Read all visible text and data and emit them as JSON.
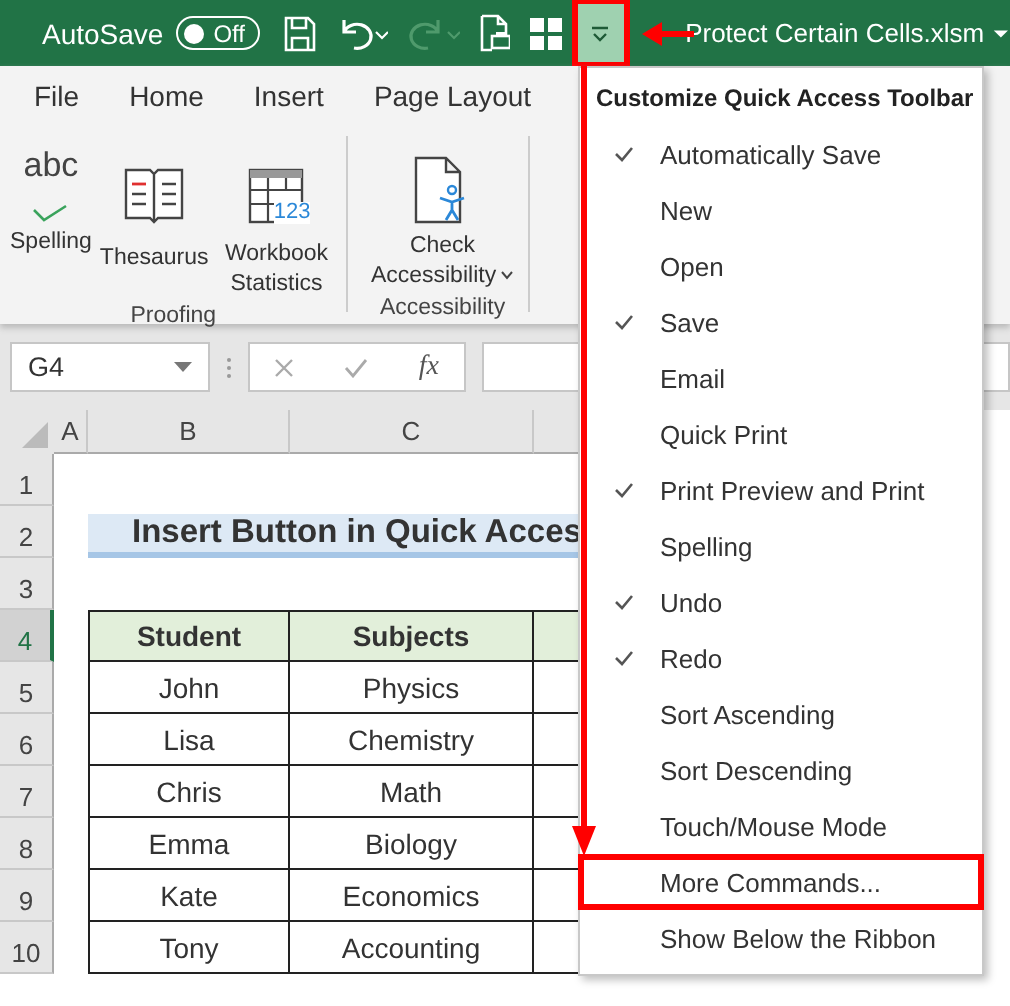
{
  "title_bar": {
    "autosave_label": "AutoSave",
    "autosave_toggle": {
      "label": "Off",
      "on": false
    },
    "redo_disabled": true,
    "filename": "Protect Certain Cells.xlsm"
  },
  "ribbon": {
    "tabs": [
      {
        "label": "File",
        "selected": false
      },
      {
        "label": "Home",
        "selected": false
      },
      {
        "label": "Insert",
        "selected": false
      },
      {
        "label": "Page Layout",
        "selected": false
      }
    ],
    "groups": [
      {
        "label": "Proofing",
        "commands": [
          {
            "kind": "spelling",
            "label": "Spelling",
            "icon_text": "abc"
          },
          {
            "kind": "thesaurus",
            "label": "Thesaurus"
          },
          {
            "kind": "statistics",
            "label": "Workbook Statistics",
            "icon_text": "123"
          }
        ]
      },
      {
        "label": "Accessibility",
        "commands": [
          {
            "kind": "accessibility",
            "label": "Check Accessibility",
            "has_menu": true
          }
        ]
      }
    ]
  },
  "formula_bar": {
    "name_box": "G4",
    "function_label": "fx"
  },
  "sheet": {
    "columns": [
      "A",
      "B",
      "C"
    ],
    "row_headers": [
      {
        "label": "1",
        "selected": false
      },
      {
        "label": "2",
        "selected": false
      },
      {
        "label": "3",
        "selected": false
      },
      {
        "label": "4",
        "selected": true
      },
      {
        "label": "5",
        "selected": false
      },
      {
        "label": "6",
        "selected": false
      },
      {
        "label": "7",
        "selected": false
      },
      {
        "label": "8",
        "selected": false
      },
      {
        "label": "9",
        "selected": false
      },
      {
        "label": "10",
        "selected": false
      }
    ],
    "title": "Insert Button in Quick Acces",
    "table_headers": [
      "Student",
      "Subjects"
    ],
    "table_rows": [
      [
        "John",
        "Physics"
      ],
      [
        "Lisa",
        "Chemistry"
      ],
      [
        "Chris",
        "Math"
      ],
      [
        "Emma",
        "Biology"
      ],
      [
        "Kate",
        "Economics"
      ],
      [
        "Tony",
        "Accounting"
      ]
    ]
  },
  "menu": {
    "title": "Customize Quick Access Toolbar",
    "items": [
      {
        "label": "Automatically Save",
        "checked": true,
        "highlighted": false
      },
      {
        "label": "New",
        "checked": false,
        "highlighted": false
      },
      {
        "label": "Open",
        "checked": false,
        "highlighted": false
      },
      {
        "label": "Save",
        "checked": true,
        "highlighted": false
      },
      {
        "label": "Email",
        "checked": false,
        "highlighted": false
      },
      {
        "label": "Quick Print",
        "checked": false,
        "highlighted": false
      },
      {
        "label": "Print Preview and Print",
        "checked": true,
        "highlighted": false
      },
      {
        "label": "Spelling",
        "checked": false,
        "highlighted": false
      },
      {
        "label": "Undo",
        "checked": true,
        "highlighted": false
      },
      {
        "label": "Redo",
        "checked": true,
        "highlighted": false
      },
      {
        "label": "Sort Ascending",
        "checked": false,
        "highlighted": false
      },
      {
        "label": "Sort Descending",
        "checked": false,
        "highlighted": false
      },
      {
        "label": "Touch/Mouse Mode",
        "checked": false,
        "highlighted": false
      },
      {
        "label": "More Commands...",
        "checked": false,
        "highlighted": true
      },
      {
        "label": "Show Below the Ribbon",
        "checked": false,
        "highlighted": false
      }
    ]
  }
}
